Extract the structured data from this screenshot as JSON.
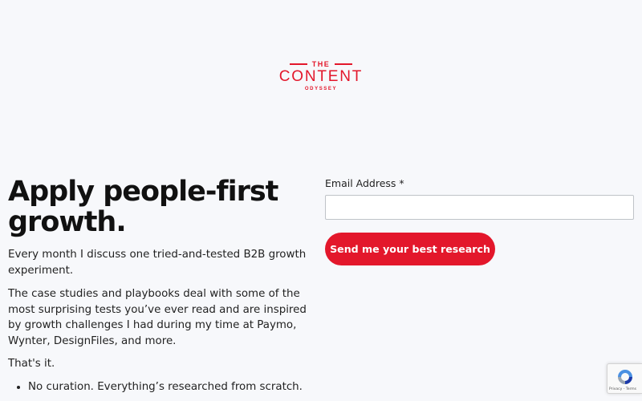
{
  "brand": {
    "the": "THE",
    "name": "CONTENT",
    "sub": "ODYSSEY",
    "color": "#e3172b"
  },
  "hero": {
    "headline": "Apply people-first growth.",
    "paragraph1": "Every month I discuss one tried-and-tested B2B growth experiment.",
    "paragraph2": "The case studies and playbooks deal with some of the most surprising tests you’ve ever read and are inspired by growth challenges I had during my time at Paymo, Wynter, DesignFiles, and more.",
    "paragraph3": "That's it.",
    "bullets": [
      "No curation. Everything’s researched from scratch."
    ]
  },
  "form": {
    "email_label": "Email Address",
    "required_mark": "*",
    "email_value": "",
    "email_placeholder": "",
    "submit_label": "Send me your best research"
  },
  "recaptcha": {
    "icon": "recaptcha-icon",
    "links": "Privacy - Terms"
  }
}
